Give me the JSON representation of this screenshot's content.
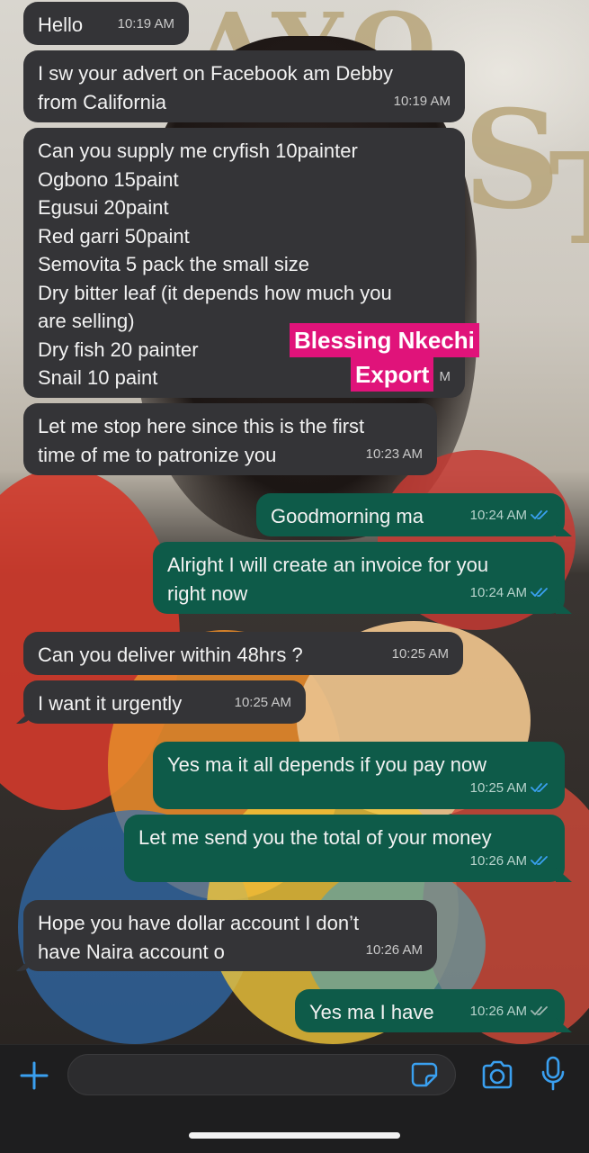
{
  "messages": [
    {
      "dir": "in",
      "text": "Hello",
      "time": "10:19 AM"
    },
    {
      "dir": "in",
      "text": "I sw your advert on Facebook am Debby\nfrom California",
      "time": "10:19 AM"
    },
    {
      "dir": "in",
      "text": "Can you supply me cryfish 10painter\nOgbono 15paint\nEgusui 20paint\nRed garri 50paint\nSemovita 5 pack the small size\nDry bitter leaf (it depends how much you\nare selling)\nDry fish 20 painter\nSnail 10 paint",
      "time": "M"
    },
    {
      "dir": "in",
      "text": "Let me stop here since this is the first\ntime of me to patronize you",
      "time": "10:23 AM"
    },
    {
      "dir": "out",
      "text": "Goodmorning ma",
      "time": "10:24 AM"
    },
    {
      "dir": "out",
      "text": "Alright I will create an invoice for you\nright now",
      "time": "10:24 AM"
    },
    {
      "dir": "in",
      "text": "Can you deliver within 48hrs ?",
      "time": "10:25 AM"
    },
    {
      "dir": "in",
      "text": "I want it urgently",
      "time": "10:25 AM"
    },
    {
      "dir": "out",
      "text": "Yes ma it all depends if you pay now",
      "time": "10:25 AM"
    },
    {
      "dir": "out",
      "text": "Let me send you the total of your money",
      "time": "10:26 AM"
    },
    {
      "dir": "in",
      "text": "Hope you have dollar account I don’t\nhave Naira account o",
      "time": "10:26 AM"
    },
    {
      "dir": "out",
      "text": "Yes ma I have",
      "time": "10:26 AM"
    }
  ],
  "watermark": {
    "line1": "Blessing Nkechi",
    "line2": "Export"
  },
  "wallpaper_letters": [
    "AYO",
    "S",
    "T"
  ],
  "composer": {
    "plus_icon": "plus-icon",
    "sticker_icon": "sticker-icon",
    "camera_icon": "camera-icon",
    "mic_icon": "microphone-icon"
  },
  "colors": {
    "incoming_bubble": "#343437",
    "outgoing_bubble": "#0e5b49",
    "accent_blue": "#3aa0f0",
    "watermark_bg": "#e0137a"
  }
}
